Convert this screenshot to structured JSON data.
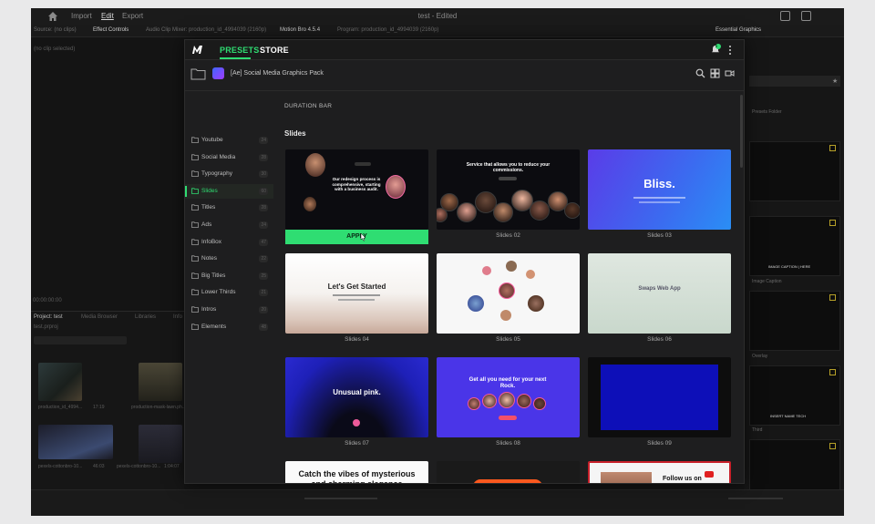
{
  "premiere": {
    "menu": {
      "import": "Import",
      "edit": "Edit",
      "export": "Export"
    },
    "window_title": "test - Edited",
    "panel_tabs": [
      "Source: (no clips)",
      "Effect Controls",
      "Audio Clip Mixer: production_id_4994039 (2160p)",
      "Motion Bro 4.5.4",
      "Program: production_id_4994039 (2160p)"
    ],
    "right_panel_title": "Essential Graphics",
    "no_clip": "(no clip selected)",
    "timecode": "00:00:00:00",
    "project_tabs": [
      "Project: test",
      "Media Browser",
      "Libraries",
      "Info"
    ],
    "project_file": "test.prproj",
    "clips": [
      {
        "name": "production_id_4994...",
        "dur": "17:19"
      },
      {
        "name": "production-mask-lawn.ph...",
        "dur": "8:00"
      },
      {
        "name": "pexels-cottonbro-10...",
        "dur": "46:03"
      },
      {
        "name": "pexels-cottonbro-10...",
        "dur": "1:04:07"
      }
    ],
    "eg_labels": [
      "Presets Folder",
      "Image Caption",
      "Overlay",
      "Third"
    ],
    "eg_texts": [
      "IMAGE CAPTION | HERE",
      "INSERT NAME TECH"
    ]
  },
  "motionbro": {
    "tabs": {
      "presets": "PRESETS",
      "store": "STORE"
    },
    "notification_count": "2",
    "pack_name": "[Ae] Social Media Graphics Pack",
    "categories": [
      {
        "label": "Youtube",
        "count": "24"
      },
      {
        "label": "Social Media",
        "count": "28"
      },
      {
        "label": "Typography",
        "count": "30"
      },
      {
        "label": "Slides",
        "count": "60"
      },
      {
        "label": "Titles",
        "count": "28"
      },
      {
        "label": "Ads",
        "count": "24"
      },
      {
        "label": "InfoBox",
        "count": "47"
      },
      {
        "label": "Notes",
        "count": "22"
      },
      {
        "label": "Big Titles",
        "count": "25"
      },
      {
        "label": "Lower Thirds",
        "count": "21"
      },
      {
        "label": "Intros",
        "count": "20"
      },
      {
        "label": "Elements",
        "count": "48"
      }
    ],
    "active_category": "Slides",
    "duration_label": "DURATION BAR",
    "section_title": "Slides",
    "apply_label": "APPLY",
    "cards": [
      {
        "caption": "Slides 01",
        "headline": "Our redesign process is comprehensive, starting with a business audit.",
        "button": "Get Started"
      },
      {
        "caption": "Slides 02",
        "headline": "Service that allows you to reduce your commissions.",
        "button": "Get Started"
      },
      {
        "caption": "Slides 03",
        "headline": "Bliss."
      },
      {
        "caption": "Slides 04",
        "headline": "Let's Get Started"
      },
      {
        "caption": "Slides 05"
      },
      {
        "caption": "Slides 06",
        "headline": "Swaps Web App"
      },
      {
        "caption": "Slides 07",
        "headline": "Unusual pink."
      },
      {
        "caption": "Slides 08",
        "headline": "Get all you need for your next Rock."
      },
      {
        "caption": "Slides 09"
      },
      {
        "headline": "Catch the vibes of mysterious and charming elegance"
      },
      {},
      {
        "headline": "Follow us on Twitter"
      }
    ],
    "colors": {
      "accent": "#2fdd72",
      "bg": "#1e1e1f",
      "purple": "#4a35e8"
    }
  }
}
